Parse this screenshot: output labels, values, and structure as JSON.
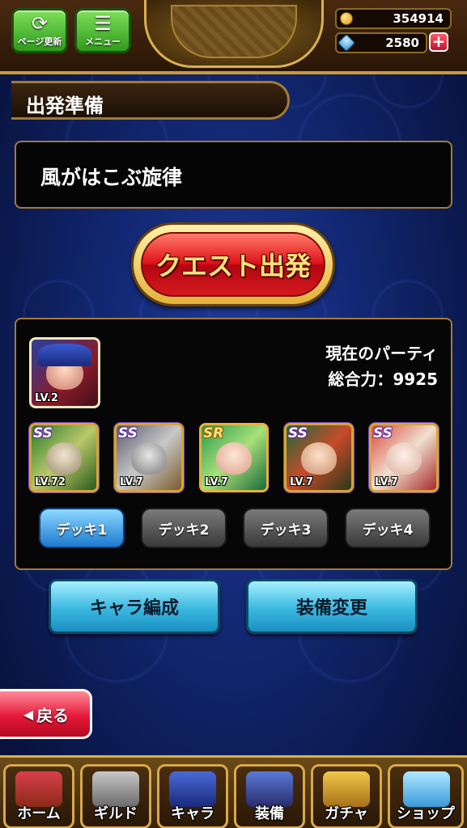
{
  "header": {
    "refresh_label": "ページ更新",
    "menu_label": "メニュー",
    "coins": "354914",
    "gems": "2580",
    "add_label": "+"
  },
  "page_title": "出発準備",
  "quest_name": "風がはこぶ旋律",
  "quest_start_label": "クエスト出発",
  "party": {
    "current_party_label": "現在のパーティ",
    "total_power_label": "総合力：9925",
    "leader_level": "LV.2",
    "members": [
      {
        "rarity": "SS",
        "level": "LV.72"
      },
      {
        "rarity": "SS",
        "level": "LV.7"
      },
      {
        "rarity": "SR",
        "level": "LV.7"
      },
      {
        "rarity": "SS",
        "level": "LV.7"
      },
      {
        "rarity": "SS",
        "level": "LV.7"
      }
    ],
    "decks": [
      "デッキ1",
      "デッキ2",
      "デッキ3",
      "デッキ4"
    ],
    "active_deck_index": 0
  },
  "actions": {
    "character_edit_label": "キャラ編成",
    "equipment_change_label": "装備変更"
  },
  "back_label": "戻る",
  "bottom_nav": [
    "ホーム",
    "ギルド",
    "キャラ",
    "装備",
    "ガチャ",
    "ショップ"
  ],
  "colors": {
    "accent_gold": "#d9b04e",
    "quest_button_red": "#e0121a",
    "action_button_cyan": "#3ab8e0",
    "back_button_red": "#e51a3a",
    "active_deck_blue": "#1e7ad0"
  }
}
